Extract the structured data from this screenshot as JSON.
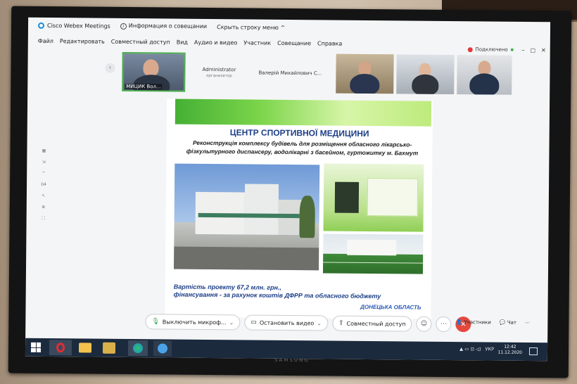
{
  "window": {
    "app_title": "Cisco Webex Meetings",
    "info_label": "Информация о совещании",
    "hide_menu": "Скрыть строку меню ^",
    "status": "Подключено",
    "controls": [
      "–",
      "▢",
      "✕"
    ]
  },
  "menu": [
    "Файл",
    "Редактировать",
    "Совместный доступ",
    "Вид",
    "Аудио и видео",
    "Участник",
    "Совещание",
    "Справка"
  ],
  "participants": {
    "active_label": "МИЦИК Вол...",
    "name_tiles": [
      {
        "name": "Administrator",
        "role": "организатор"
      },
      {
        "name": "Валерій Михайлович С...",
        "role": ""
      }
    ]
  },
  "slide": {
    "title": "ЦЕНТР СПОРТИВНОЇ МЕДИЦИНИ",
    "subtitle_line1": "Реконструкція комплексу будівель для розміщення обласного лікарсько-",
    "subtitle_line2": "фізкультурного диспансеру, водолікарні з басейном, гуртожитку м. Бахмут",
    "cost_line1": "Вартість  проекту 67,2 млн. грн.,",
    "cost_line2": "фінансування -  за рахунок коштів ДФРР та обласного  бюджету",
    "region": "ДОНЕЦЬКА ОБЛАСТЬ"
  },
  "sidebar": {
    "page": "04"
  },
  "controls": {
    "mute": "Выключить микроф...",
    "video": "Остановить видео",
    "share": "Совместный доступ",
    "participants": "Участники",
    "chat": "Чат"
  },
  "taskbar": {
    "lang": "УКР",
    "time": "12:42",
    "date": "11.12.2020"
  },
  "monitor": {
    "brand": "SAMSUNG"
  },
  "colors": {
    "accent": "#1a8ed8",
    "end": "#e5483e",
    "slide_title": "#1d3f88",
    "green_bar": "#45b035"
  }
}
